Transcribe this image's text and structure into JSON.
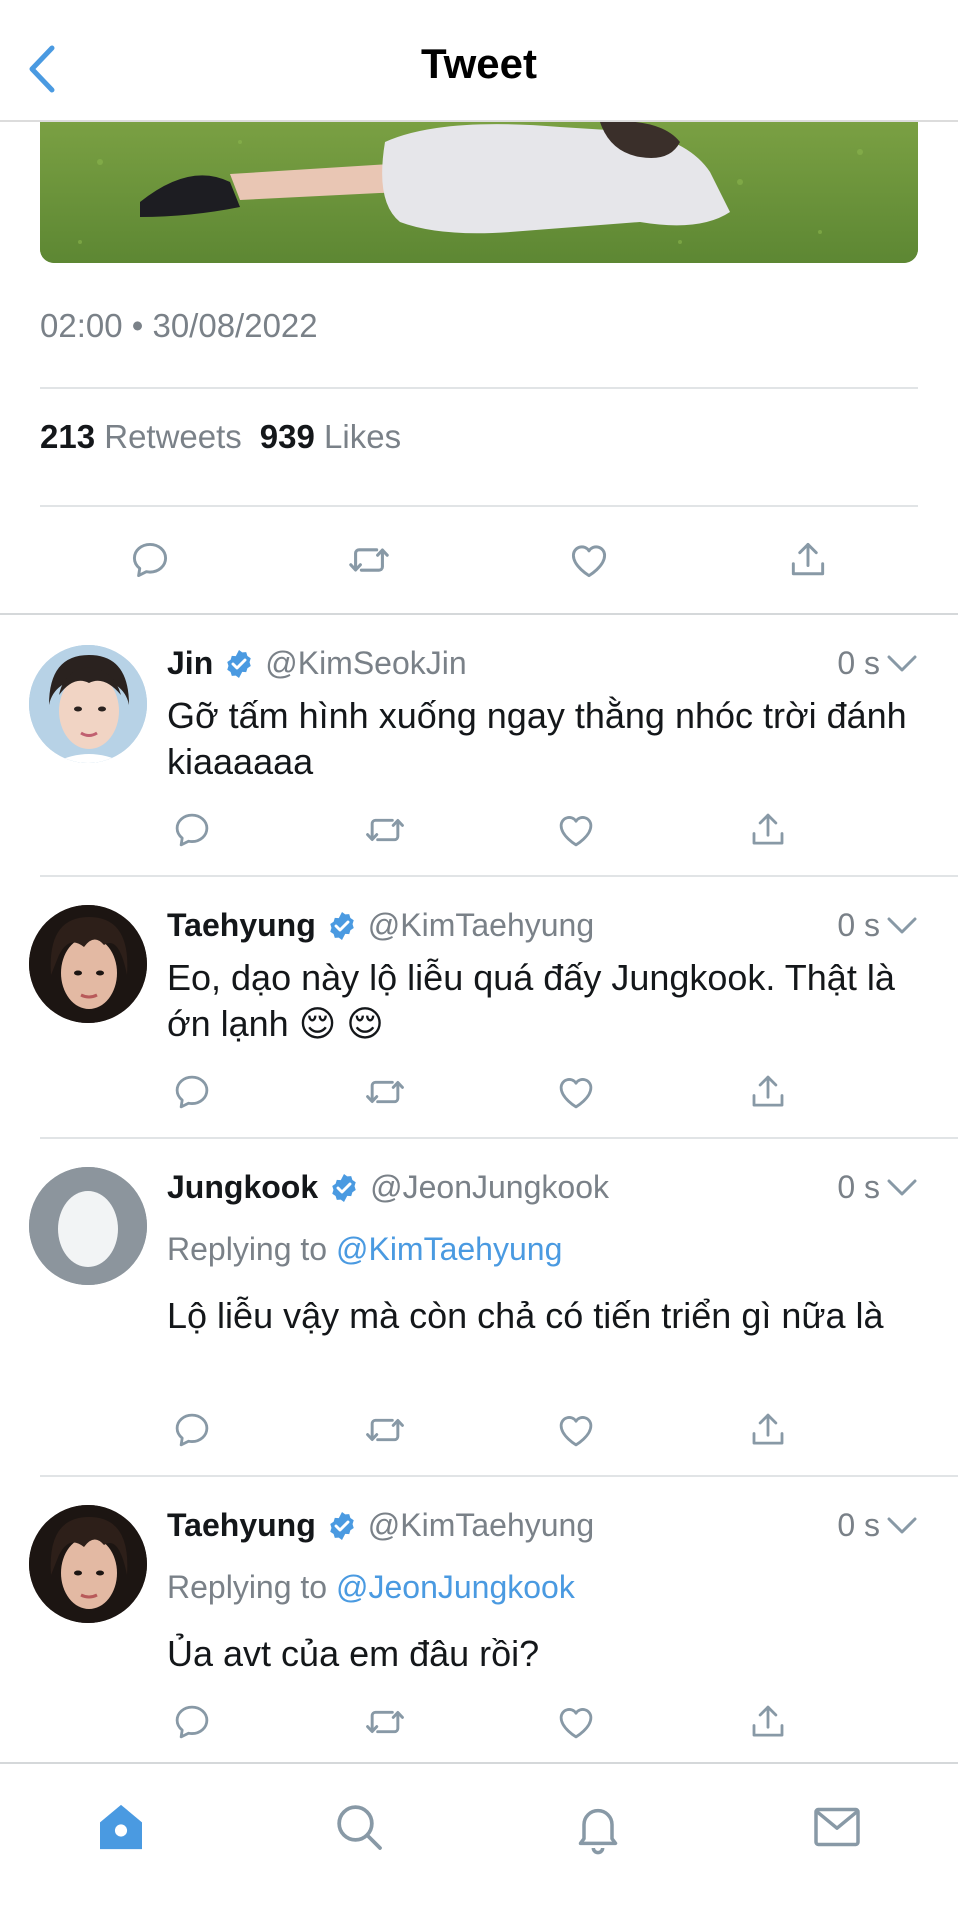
{
  "header": {
    "title": "Tweet"
  },
  "tweet": {
    "timestamp": "02:00 • 30/08/2022",
    "retweets_count": "213",
    "retweets_label": "Retweets",
    "likes_count": "939",
    "likes_label": "Likes"
  },
  "replies": [
    {
      "name": "Jin",
      "handle": "@KimSeokJin",
      "time": "0 s",
      "text": "Gỡ tấm hình xuống ngay thằng nhóc trời đánh kiaaaaaa"
    },
    {
      "name": "Taehyung",
      "handle": "@KimTaehyung",
      "time": "0 s",
      "text": "Eo, dạo này lộ liễu quá đấy Jungkook. Thật là ớn lạnh 😌 😌"
    },
    {
      "name": "Jungkook",
      "handle": "@JeonJungkook",
      "time": "0 s",
      "replying_prefix": "Replying to",
      "replying_to": "@KimTaehyung",
      "text": "Lộ liễu vậy mà còn chả có tiến triển gì nữa là"
    },
    {
      "name": "Taehyung",
      "handle": "@KimTaehyung",
      "time": "0 s",
      "replying_prefix": "Replying to",
      "replying_to": "@JeonJungkook",
      "text": "Ủa avt của em đâu rồi?"
    }
  ],
  "colors": {
    "accent": "#4a9ae1",
    "muted_text": "#7a8188",
    "icon_gray": "#8899a6",
    "divider": "#e1e4e6"
  },
  "icons": {
    "back": "chevron-left-icon",
    "reply": "reply-icon",
    "retweet": "retweet-icon",
    "like": "heart-icon",
    "share": "share-icon",
    "verified": "verified-badge-icon",
    "more": "chevron-down-icon",
    "tabs": [
      "home-icon",
      "search-icon",
      "bell-icon",
      "mail-icon"
    ]
  }
}
